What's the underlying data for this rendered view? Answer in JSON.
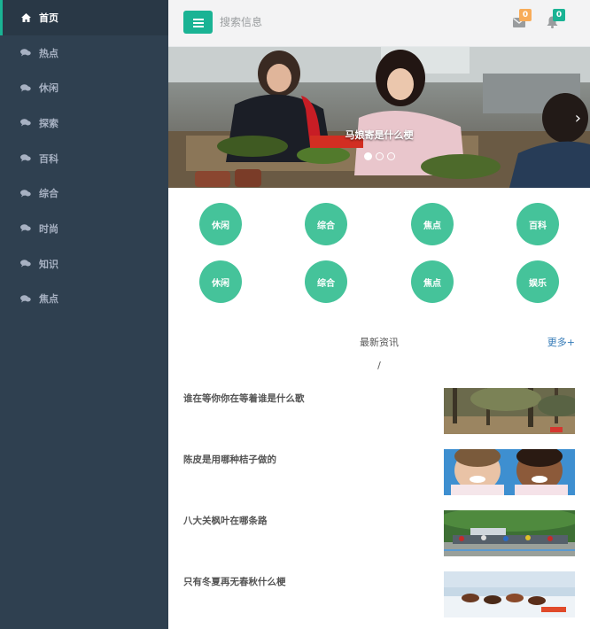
{
  "sidebar": {
    "items": [
      {
        "label": "首页",
        "icon": "home-icon",
        "active": true
      },
      {
        "label": "热点",
        "icon": "comments-icon"
      },
      {
        "label": "休闲",
        "icon": "comments-icon"
      },
      {
        "label": "探索",
        "icon": "comments-icon"
      },
      {
        "label": "百科",
        "icon": "comments-icon"
      },
      {
        "label": "综合",
        "icon": "comments-icon"
      },
      {
        "label": "时尚",
        "icon": "comments-icon"
      },
      {
        "label": "知识",
        "icon": "comments-icon"
      },
      {
        "label": "焦点",
        "icon": "comments-icon"
      }
    ]
  },
  "topbar": {
    "search_placeholder": "搜索信息",
    "mail_count": "0",
    "bell_count": "0"
  },
  "banner": {
    "caption": "马娘寄是什么梗",
    "slide_count": 3,
    "active_slide": 1
  },
  "categories": [
    {
      "label": "休闲"
    },
    {
      "label": "综合"
    },
    {
      "label": "焦点"
    },
    {
      "label": "百科"
    },
    {
      "label": "休闲"
    },
    {
      "label": "综合"
    },
    {
      "label": "焦点"
    },
    {
      "label": "娱乐"
    }
  ],
  "news": {
    "title": "最新资讯",
    "more_label": "更多+",
    "separator": "/",
    "items": [
      {
        "title": "谁在等你你在等着谁是什么歌",
        "thumb": "forest-photo"
      },
      {
        "title": "陈皮是用哪种桔子做的",
        "thumb": "children-photo"
      },
      {
        "title": "八大关枫叶在哪条路",
        "thumb": "cycling-race-photo"
      },
      {
        "title": "只有冬夏再无春秋什么梗",
        "thumb": "snow-horses-photo"
      }
    ]
  },
  "colors": {
    "sidebar_bg": "#2f4050",
    "accent": "#1ab394",
    "category_circle": "#45c39a",
    "badge_orange": "#f8ac59"
  }
}
